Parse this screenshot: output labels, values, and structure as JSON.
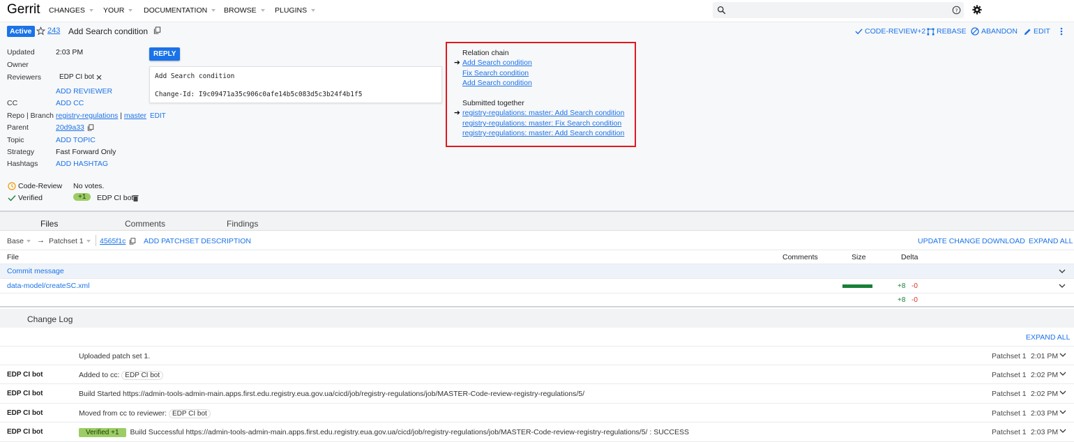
{
  "topbar": {
    "logo": "Gerrit",
    "menus": [
      "CHANGES",
      "YOUR",
      "DOCUMENTATION",
      "BROWSE",
      "PLUGINS"
    ],
    "search": {
      "value": "",
      "placeholder": ""
    }
  },
  "header": {
    "status": "Active",
    "change_number": "243",
    "title": "Add Search condition",
    "actions": [
      "CODE-REVIEW+2",
      "REBASE",
      "ABANDON",
      "EDIT"
    ]
  },
  "info": {
    "updated_label": "Updated",
    "updated_value": "2:03 PM",
    "owner_label": "Owner",
    "reviewers_label": "Reviewers",
    "reviewer_chip": "EDP CI bot",
    "add_reviewer": "ADD REVIEWER",
    "cc_label": "CC",
    "add_cc": "ADD CC",
    "repo_label": "Repo | Branch",
    "repo": "registry-regulations",
    "sep": "|",
    "branch": "master",
    "edit": "EDIT",
    "parent_label": "Parent",
    "parent": "20d9a33",
    "topic_label": "Topic",
    "add_topic": "ADD TOPIC",
    "strategy_label": "Strategy",
    "strategy": "Fast Forward Only",
    "hashtags_label": "Hashtags",
    "add_hashtag": "ADD HASHTAG",
    "code_review_label": "Code-Review",
    "code_review_value": "No votes.",
    "verified_label": "Verified",
    "verified_vote": "+1",
    "verified_by": "EDP CI bot"
  },
  "reply": {
    "label": "REPLY"
  },
  "commit_message": {
    "subject": "Add Search condition",
    "change_id": "Change-Id: I9c09471a35c906c0afe14b5c083d5c3b24f4b1f5"
  },
  "related": {
    "relation_chain_title": "Relation chain",
    "relation_chain": [
      "Add Search condition",
      "Fix Search condition",
      "Add Search condition"
    ],
    "submitted_title": "Submitted together",
    "submitted": [
      "registry-regulations: master: Add Search condition",
      "registry-regulations: master: Fix Search condition",
      "registry-regulations: master: Add Search condition"
    ]
  },
  "tabs": [
    "Files",
    "Comments",
    "Findings"
  ],
  "files_bar": {
    "base": "Base",
    "arrow": "→",
    "patchset": "Patchset 1",
    "commit": "4565f1c",
    "add_desc": "ADD PATCHSET DESCRIPTION",
    "update_change": "UPDATE CHANGE",
    "download": "DOWNLOAD",
    "expand_all": "EXPAND ALL"
  },
  "file_table": {
    "headers": {
      "file": "File",
      "comments": "Comments",
      "size": "Size",
      "delta": "Delta"
    },
    "commit_row": "Commit message",
    "file_name": "data-model/createSC.xml",
    "file_plus": "+8",
    "file_minus": "-0",
    "total_plus": "+8",
    "total_minus": "-0"
  },
  "changelog": {
    "title": "Change Log",
    "expand_all": "EXPAND ALL",
    "rows": [
      {
        "author": "",
        "pre": "",
        "msg": "Uploaded patch set 1.",
        "chip": "",
        "badge": "",
        "ps": "Patchset 1",
        "time": "2:01 PM"
      },
      {
        "author": "EDP CI bot",
        "msg": "Added to cc:",
        "chip": "EDP CI bot",
        "badge": "",
        "ps": "Patchset 1",
        "time": "2:02 PM"
      },
      {
        "author": "EDP CI bot",
        "msg": "Build Started https://admin-tools-admin-main.apps.first.edu.registry.eua.gov.ua/cicd/job/registry-regulations/job/MASTER-Code-review-registry-regulations/5/",
        "chip": "",
        "badge": "",
        "ps": "Patchset 1",
        "time": "2:02 PM"
      },
      {
        "author": "EDP CI bot",
        "msg": "Moved from cc to reviewer:",
        "chip": "EDP CI bot",
        "badge": "",
        "ps": "Patchset 1",
        "time": "2:03 PM"
      },
      {
        "author": "EDP CI bot",
        "msg": "Build Successful https://admin-tools-admin-main.apps.first.edu.registry.eua.gov.ua/cicd/job/registry-regulations/job/MASTER-Code-review-registry-regulations/5/ : SUCCESS",
        "chip": "",
        "badge": "Verified +1",
        "ps": "Patchset 1",
        "time": "2:03 PM"
      }
    ]
  },
  "colors": {
    "accent": "#1a73e8",
    "highlight_border": "#e0181e",
    "size_bar": "#188038",
    "verified": "#9ccc65"
  }
}
